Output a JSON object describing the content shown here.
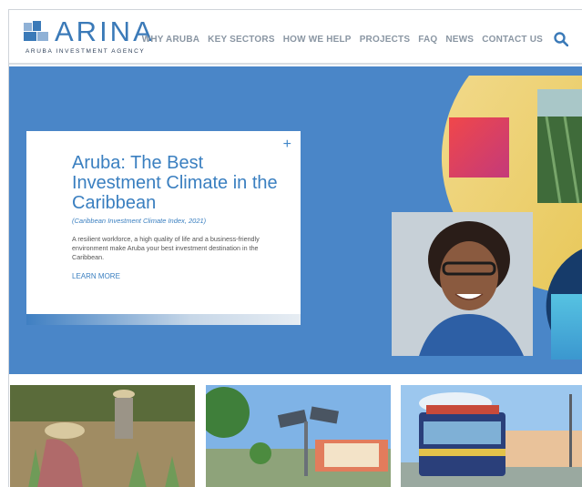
{
  "brand": {
    "name": "ARINA",
    "tagline": "ARUBA INVESTMENT AGENCY",
    "color": "#3b7ab8"
  },
  "nav": {
    "items": [
      {
        "label": "WHY ARUBA"
      },
      {
        "label": "KEY SECTORS"
      },
      {
        "label": "HOW WE HELP"
      },
      {
        "label": "PROJECTS"
      },
      {
        "label": "FAQ"
      },
      {
        "label": "NEWS"
      },
      {
        "label": "CONTACT US"
      }
    ],
    "search_icon": "search-icon"
  },
  "hero": {
    "background": "#4a86c8",
    "title": "Aruba: The Best Investment Climate in the Caribbean",
    "subtitle": "(Caribbean Investment Climate Index, 2021)",
    "body": "A resilient workforce, a high quality of life and a business-friendly environment make Aruba your best investment destination in the Caribbean.",
    "cta": "LEARN MORE",
    "expand_icon": "plus-icon"
  },
  "thumbnails": [
    {
      "subject": "farmers-aloe-field"
    },
    {
      "subject": "solar-trees-plaza"
    },
    {
      "subject": "tram-street"
    }
  ]
}
